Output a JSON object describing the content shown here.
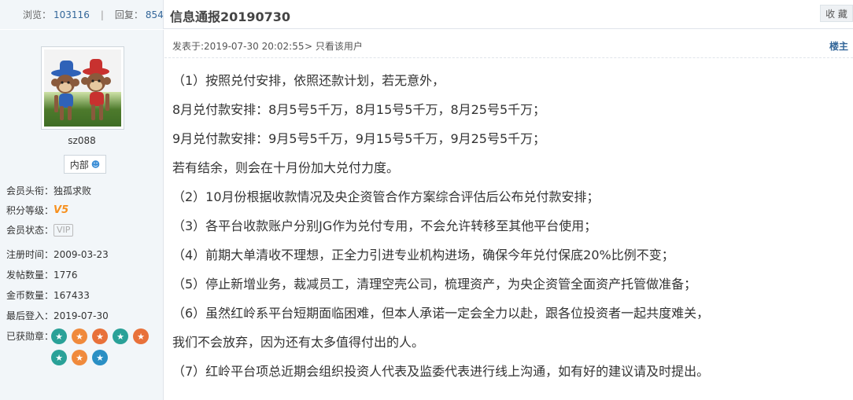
{
  "header": {
    "views_label": "浏览：",
    "views": "103116",
    "replies_label": "回复：",
    "replies": "854",
    "separator": "|",
    "title": "信息通报20190730",
    "favorite_label": "收 藏"
  },
  "user": {
    "name": "sz088",
    "role": "内部",
    "info": [
      {
        "label": "会员头衔：",
        "value": "独孤求败"
      },
      {
        "label": "积分等级：",
        "value": "V5"
      },
      {
        "label": "会员状态：",
        "value": "VIP"
      },
      {
        "label": "注册时间：",
        "value": "2009-03-23"
      },
      {
        "label": "发帖数量：",
        "value": "1776"
      },
      {
        "label": "金币数量：",
        "value": "167433"
      },
      {
        "label": "最后登入：",
        "value": "2019-07-30"
      },
      {
        "label": "已获勋章：",
        "value": ""
      }
    ],
    "medal_colors": [
      "#2aa198",
      "#f08a3c",
      "#e8713a",
      "#2aa198",
      "#e8713a",
      "#2aa198",
      "#f08a3c",
      "#2a8fc4"
    ]
  },
  "post": {
    "time": "发表于:2019-07-30 20:02:55",
    "only_user": "> 只看该用户",
    "floor": "楼主",
    "lines": [
      "（1）按照兑付安排，依照还款计划，若无意外，",
      "8月兑付款安排：8月5号5千万，8月15号5千万，8月25号5千万；",
      "9月兑付款安排：9月5号5千万，9月15号5千万，9月25号5千万；",
      "若有结余，则会在十月份加大兑付力度。",
      "（2）10月份根据收款情况及央企资管合作方案综合评估后公布兑付款安排；",
      "（3）各平台收款账户分别JG作为兑付专用，不会允许转移至其他平台使用；",
      "（4）前期大单清收不理想，正全力引进专业机构进场，确保今年兑付保底20%比例不变；",
      "（5）停止新增业务，裁减员工，清理空壳公司，梳理资产，为央企资管全面资产托管做准备；",
      "（6）虽然红岭系平台短期面临困难，但本人承诺一定会全力以赴，跟各位投资者一起共度难关，",
      "我们不会放弃，因为还有太多值得付出的人。",
      "（7）红岭平台项总近期会组织投资人代表及监委代表进行线上沟通，如有好的建议请及时提出。"
    ]
  }
}
